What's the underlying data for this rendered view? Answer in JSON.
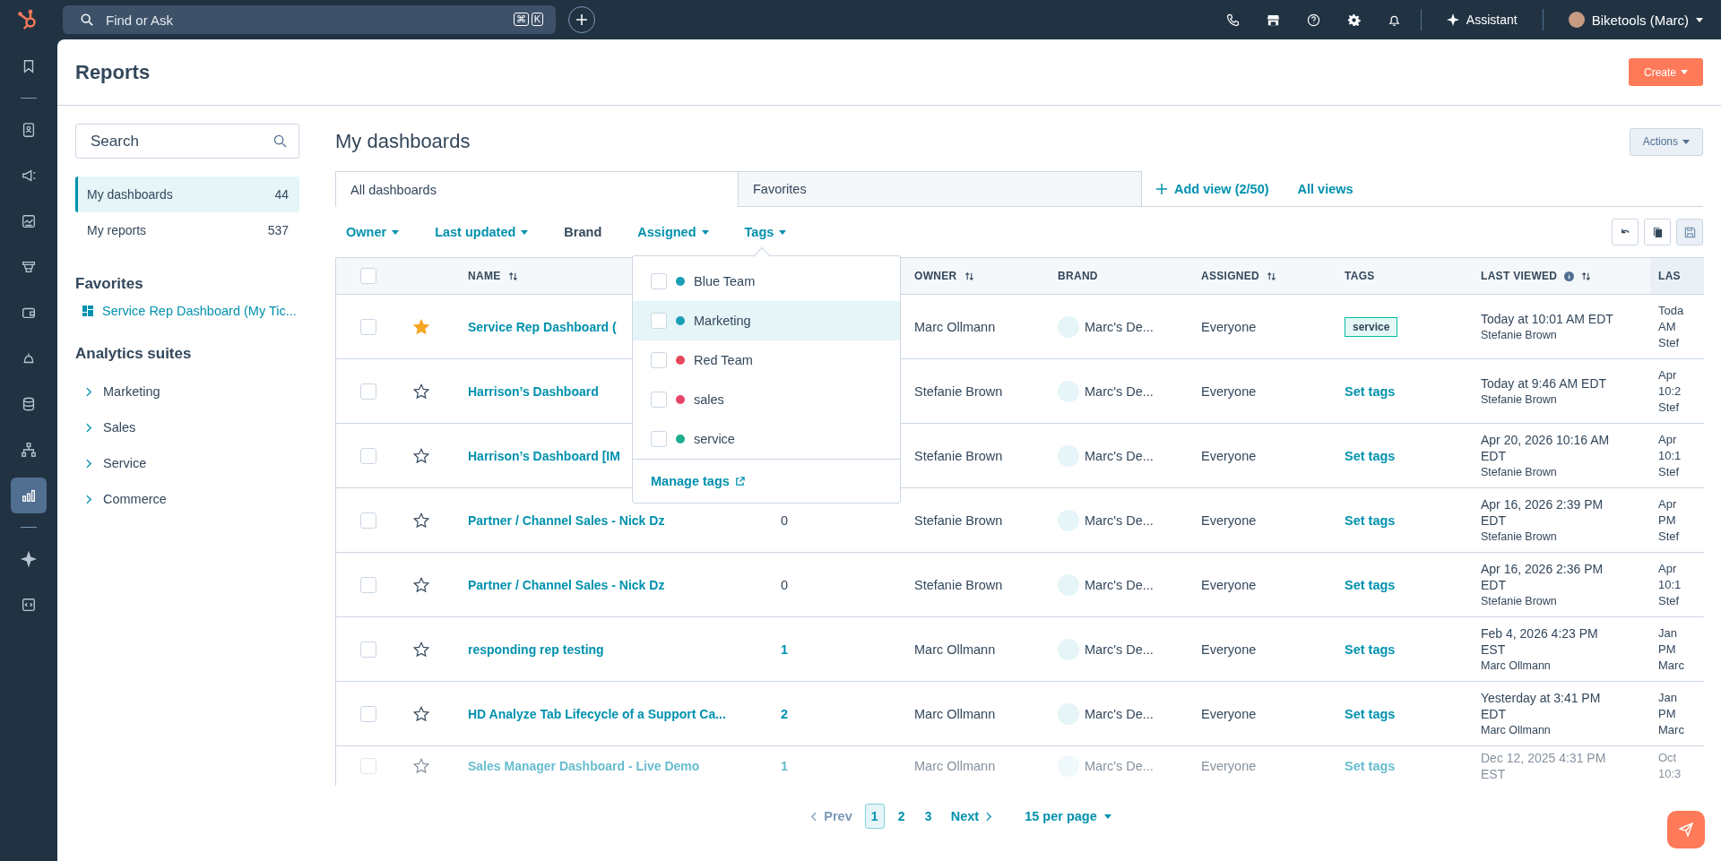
{
  "top_bar": {
    "search_placeholder": "Find or Ask",
    "shortcut_keys": [
      "⌘",
      "K"
    ],
    "assistant": "Assistant",
    "account": "Biketools (Marc)"
  },
  "nav_rail": [
    {
      "kind": "bookmark",
      "selected": false
    },
    {
      "kind": "divider"
    },
    {
      "kind": "contacts",
      "selected": false
    },
    {
      "kind": "megaphone",
      "selected": false
    },
    {
      "kind": "content",
      "selected": false
    },
    {
      "kind": "funnel",
      "selected": false
    },
    {
      "kind": "wallet",
      "selected": false
    },
    {
      "kind": "bell",
      "selected": false
    },
    {
      "kind": "database",
      "selected": false
    },
    {
      "kind": "hierarchy",
      "selected": false
    },
    {
      "kind": "chart",
      "selected": true
    },
    {
      "kind": "divider"
    },
    {
      "kind": "sparkle",
      "selected": false
    },
    {
      "kind": "code",
      "selected": false
    }
  ],
  "page": {
    "title": "Reports",
    "create_button": "Create"
  },
  "sidebar": {
    "search_placeholder": "Search",
    "views": [
      {
        "label": "My dashboards",
        "count": "44",
        "selected": true
      },
      {
        "label": "My reports",
        "count": "537",
        "selected": false
      }
    ],
    "favorites_heading": "Favorites",
    "favorites": [
      "Service Rep Dashboard (My Tic..."
    ],
    "suites_heading": "Analytics suites",
    "suites": [
      "Marketing",
      "Sales",
      "Service",
      "Commerce"
    ]
  },
  "main": {
    "title": "My dashboards",
    "actions_button": "Actions",
    "tabs": [
      {
        "label": "All dashboards",
        "selected": true
      },
      {
        "label": "Favorites",
        "selected": false
      }
    ],
    "add_view": "Add view (2/50)",
    "all_views": "All views",
    "filters": [
      {
        "label": "Owner",
        "kind": "dropdown"
      },
      {
        "label": "Last updated",
        "kind": "dropdown"
      },
      {
        "label": "Brand",
        "kind": "plain"
      },
      {
        "label": "Assigned",
        "kind": "dropdown"
      },
      {
        "label": "Tags",
        "kind": "dropdown"
      }
    ]
  },
  "tags_menu": {
    "options": [
      {
        "label": "Blue Team",
        "color": "#1a9fb5",
        "checked": false,
        "highlighted": false
      },
      {
        "label": "Marketing",
        "color": "#1a9fb5",
        "checked": false,
        "highlighted": true
      },
      {
        "label": "Red Team",
        "color": "#e5485a",
        "checked": false,
        "highlighted": false
      },
      {
        "label": "sales",
        "color": "#e8456d",
        "checked": false,
        "highlighted": false
      },
      {
        "label": "service",
        "color": "#1fae8c",
        "checked": false,
        "highlighted": false
      }
    ],
    "manage_link": "Manage tags"
  },
  "table": {
    "select_all_checked": false,
    "columns": [
      {
        "label": "NAME",
        "sortable": true,
        "info": false
      },
      {
        "label": "OWNER",
        "sortable": true,
        "info": false
      },
      {
        "label": "BRAND",
        "sortable": false,
        "info": false
      },
      {
        "label": "ASSIGNED",
        "sortable": true,
        "info": false
      },
      {
        "label": "TAGS",
        "sortable": false,
        "info": false
      },
      {
        "label": "LAST VIEWED",
        "sortable": true,
        "info": true
      },
      {
        "label": "LAS"
      }
    ],
    "rows": [
      {
        "checked": false,
        "starred": true,
        "name": "Service Rep Dashboard (",
        "owner": "Marc Ollmann",
        "brand": "Marc's De...",
        "assigned": "Everyone",
        "tag": {
          "kind": "chip",
          "text": "service"
        },
        "last_viewed": "Today at 10:01 AM EDT",
        "viewed_by": "Stefanie Brown",
        "last_column": [
          "Toda",
          "AM",
          "Stef"
        ]
      },
      {
        "checked": false,
        "starred": false,
        "name": "Harrison’s Dashboard",
        "owner": "Stefanie Brown",
        "brand": "Marc's De...",
        "assigned": "Everyone",
        "tag": {
          "kind": "link",
          "text": "Set tags"
        },
        "last_viewed": "Today at 9:46 AM EDT",
        "viewed_by": "Stefanie Brown",
        "last_column": [
          "Apr",
          "10:2",
          "Stef"
        ]
      },
      {
        "checked": false,
        "starred": false,
        "name": "Harrison’s Dashboard [IM",
        "owner": "Stefanie Brown",
        "brand": "Marc's De...",
        "assigned": "Everyone",
        "tag": {
          "kind": "link",
          "text": "Set tags"
        },
        "last_viewed": "Apr 20, 2026 10:16 AM EDT",
        "viewed_by": "Stefanie Brown",
        "last_column": [
          "Apr",
          "10:1",
          "Stef"
        ]
      },
      {
        "checked": false,
        "starred": false,
        "name": "Partner / Channel Sales - Nick Dz",
        "column_3": {
          "text": "0",
          "link": false
        },
        "owner": "Stefanie Brown",
        "brand": "Marc's De...",
        "assigned": "Everyone",
        "tag": {
          "kind": "link",
          "text": "Set tags"
        },
        "last_viewed": "Apr 16, 2026 2:39 PM EDT",
        "viewed_by": "Stefanie Brown",
        "last_column": [
          "Apr",
          "PM",
          "Stef"
        ]
      },
      {
        "checked": false,
        "starred": false,
        "name": "Partner / Channel Sales - Nick Dz",
        "column_3": {
          "text": "0",
          "link": false
        },
        "owner": "Stefanie Brown",
        "brand": "Marc's De...",
        "assigned": "Everyone",
        "tag": {
          "kind": "link",
          "text": "Set tags"
        },
        "last_viewed": "Apr 16, 2026 2:36 PM EDT",
        "viewed_by": "Stefanie Brown",
        "last_column": [
          "Apr",
          "10:1",
          "Stef"
        ]
      },
      {
        "checked": false,
        "starred": false,
        "name": "responding rep testing",
        "column_3": {
          "text": "1",
          "link": true
        },
        "owner": "Marc Ollmann",
        "brand": "Marc's De...",
        "assigned": "Everyone",
        "tag": {
          "kind": "link",
          "text": "Set tags"
        },
        "last_viewed": "Feb 4, 2026 4:23 PM EST",
        "viewed_by": "Marc Ollmann",
        "last_column": [
          "Jan",
          "PM",
          "Marc"
        ]
      },
      {
        "checked": false,
        "starred": false,
        "name": "HD Analyze Tab Lifecycle of a Support Ca...",
        "column_3": {
          "text": "2",
          "link": true
        },
        "owner": "Marc Ollmann",
        "brand": "Marc's De...",
        "assigned": "Everyone",
        "tag": {
          "kind": "link",
          "text": "Set tags"
        },
        "last_viewed": "Yesterday at 3:41 PM EDT",
        "viewed_by": "Marc Ollmann",
        "last_column": [
          "Jan",
          "PM",
          "Marc"
        ]
      },
      {
        "checked": false,
        "starred": false,
        "name": "Sales Manager Dashboard - Live Demo",
        "column_3": {
          "text": "1",
          "link": true
        },
        "owner": "Marc Ollmann",
        "brand": "Marc's De...",
        "assigned": "Everyone",
        "tag": {
          "kind": "link",
          "text": "Set tags"
        },
        "last_viewed": "Dec 12, 2025 4:31 PM EST",
        "last_column": [
          "Oct",
          "10:3"
        ]
      }
    ]
  },
  "pagination": {
    "prev": "Prev",
    "prev_disabled": true,
    "pages": [
      {
        "label": "1",
        "selected": true
      },
      {
        "label": "2",
        "selected": false
      },
      {
        "label": "3",
        "selected": false
      }
    ],
    "next": "Next",
    "per_page": "15 per page"
  }
}
